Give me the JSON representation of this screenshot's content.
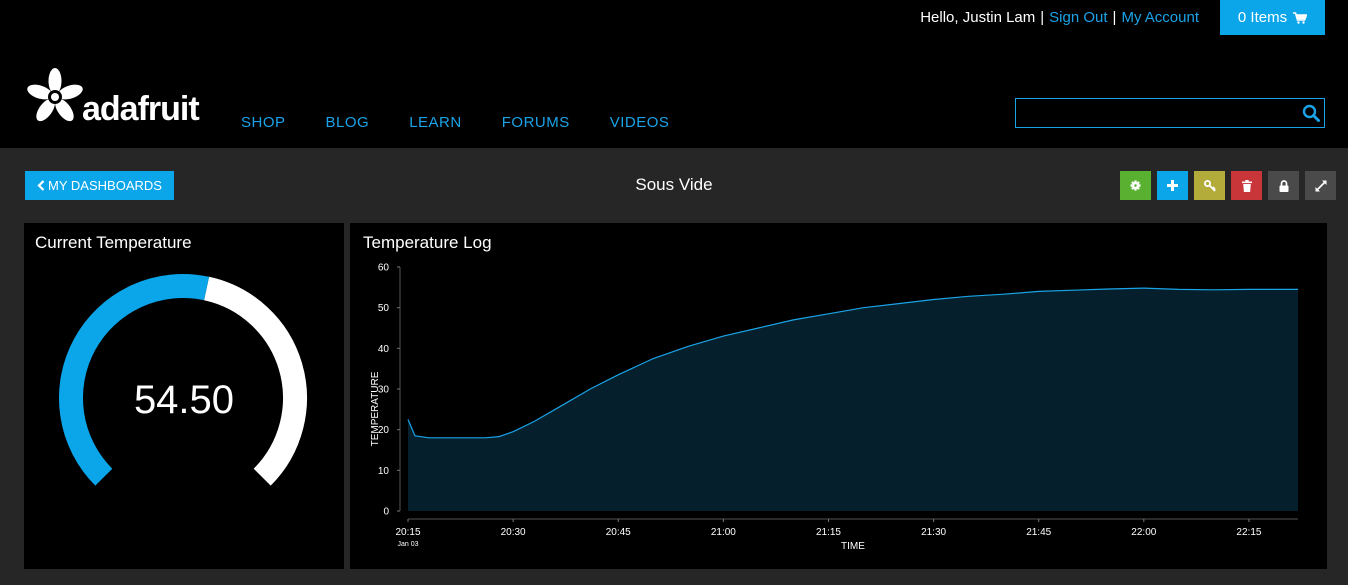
{
  "user_bar": {
    "greeting": "Hello, Justin Lam",
    "separator": "|",
    "sign_out": "Sign Out",
    "my_account": "My Account",
    "cart_label": "0 Items",
    "cart_icon": "cart-icon"
  },
  "brand": {
    "logo_text": "adafruit",
    "logo_icon": "adafruit-flower-icon"
  },
  "nav": {
    "items": [
      "SHOP",
      "BLOG",
      "LEARN",
      "FORUMS",
      "VIDEOS"
    ]
  },
  "search": {
    "value": "",
    "placeholder": "",
    "icon": "search-icon"
  },
  "dashboard": {
    "back_label": "MY DASHBOARDS",
    "back_icon": "chevron-left-icon",
    "title": "Sous Vide",
    "toolbar": [
      {
        "name": "settings",
        "icon": "gear-icon",
        "color": "#5ab031"
      },
      {
        "name": "add",
        "icon": "plus-icon",
        "color": "#0ba5ea"
      },
      {
        "name": "key",
        "icon": "key-icon",
        "color": "#b3ac3b"
      },
      {
        "name": "delete",
        "icon": "trash-icon",
        "color": "#c9363a"
      },
      {
        "name": "lock",
        "icon": "lock-icon",
        "color": "#4a4a4a"
      },
      {
        "name": "fullscreen",
        "icon": "expand-icon",
        "color": "#4a4a4a"
      }
    ]
  },
  "gauge_block": {
    "title": "Current Temperature",
    "value_text": "54.50",
    "value": 54.5,
    "fill_color": "#0ba5ea",
    "track_color": "#ffffff"
  },
  "chart_data": {
    "type": "area",
    "title": "Temperature Log",
    "xlabel": "TIME",
    "ylabel": "TEMPERATURE",
    "ylim": [
      0,
      60
    ],
    "yticks": [
      0,
      10,
      20,
      30,
      40,
      50,
      60
    ],
    "xticks": [
      "20:15",
      "20:30",
      "20:45",
      "21:00",
      "21:15",
      "21:30",
      "21:45",
      "22:00",
      "22:15"
    ],
    "xtick_sublabel": "Jan 03",
    "xlim": [
      "20:15",
      "22:22"
    ],
    "line_color": "#1aa3e8",
    "fill_color": "#05202c",
    "series": [
      {
        "x": [
          "20:15",
          "20:16",
          "20:18",
          "20:22",
          "20:26",
          "20:28",
          "20:30",
          "20:33",
          "20:37",
          "20:41",
          "20:45",
          "20:50",
          "20:55",
          "21:00",
          "21:05",
          "21:10",
          "21:15",
          "21:20",
          "21:25",
          "21:30",
          "21:35",
          "21:40",
          "21:45",
          "21:50",
          "21:55",
          "22:00",
          "22:05",
          "22:10",
          "22:15",
          "22:22"
        ],
        "values": [
          22.5,
          18.5,
          18.0,
          18.0,
          18.0,
          18.3,
          19.5,
          22.0,
          26.0,
          30.0,
          33.5,
          37.5,
          40.5,
          43.0,
          45.0,
          47.0,
          48.5,
          50.0,
          51.0,
          52.0,
          52.8,
          53.3,
          54.0,
          54.3,
          54.6,
          54.8,
          54.5,
          54.4,
          54.5,
          54.5
        ]
      }
    ]
  }
}
